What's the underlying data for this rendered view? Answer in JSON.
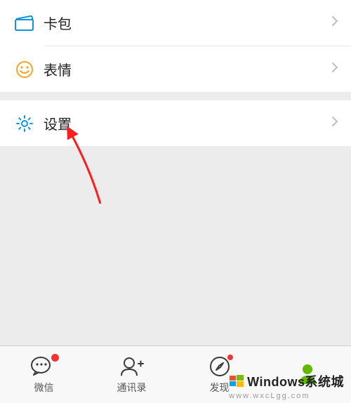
{
  "menu": {
    "items": [
      {
        "key": "cards",
        "label": "卡包",
        "icon": "wallet-icon",
        "icon_color": "#1296db"
      },
      {
        "key": "stickers",
        "label": "表情",
        "icon": "smiley-icon",
        "icon_color": "#f5a623"
      },
      {
        "key": "settings",
        "label": "设置",
        "icon": "gear-icon",
        "icon_color": "#1296db"
      }
    ]
  },
  "tabbar": {
    "tabs": [
      {
        "key": "wechat",
        "label": "微信",
        "icon": "chat-icon",
        "badge": true
      },
      {
        "key": "contacts",
        "label": "通讯录",
        "icon": "contacts-icon",
        "badge": false
      },
      {
        "key": "discover",
        "label": "发现",
        "icon": "compass-icon",
        "badge": true
      },
      {
        "key": "me",
        "label": "",
        "icon": "person-icon",
        "badge": false,
        "active_color": "#62b900"
      }
    ]
  },
  "watermark": {
    "title": "Windows系统城",
    "url": "www.wxcLgg.com"
  },
  "annotation": {
    "arrow_color": "#fa1e1e"
  }
}
